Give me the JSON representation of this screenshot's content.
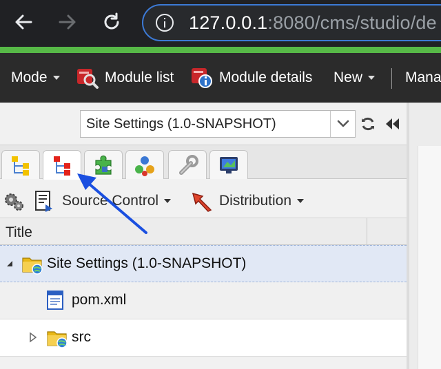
{
  "browser": {
    "url_host": "127.0.0.1",
    "url_path": ":8080/cms/studio/de",
    "icons": [
      "back-arrow-icon",
      "forward-arrow-icon",
      "reload-icon",
      "info-icon"
    ]
  },
  "toolbar": {
    "mode_label": "Mode",
    "module_list_label": "Module list",
    "module_details_label": "Module details",
    "new_label": "New",
    "manage_label": "Mana"
  },
  "site_select": {
    "value": "Site Settings (1.0-SNAPSHOT)"
  },
  "tabs": [
    {
      "icon": "site-tree-icon"
    },
    {
      "icon": "red-tree-icon"
    },
    {
      "icon": "puzzle-icon"
    },
    {
      "icon": "components-icon"
    },
    {
      "icon": "wrench-icon"
    },
    {
      "icon": "monitor-icon"
    }
  ],
  "tools": {
    "source_control_label": "Source Control",
    "distribution_label": "Distribution"
  },
  "tree": {
    "column_title": "Title",
    "rows": [
      {
        "label": "Site Settings (1.0-SNAPSHOT)",
        "icon": "site-folder-icon"
      },
      {
        "label": "pom.xml",
        "icon": "file-icon"
      },
      {
        "label": "src",
        "icon": "folder-icon"
      }
    ]
  },
  "colors": {
    "accent_blue": "#1a4fe0",
    "load_bar": "#57b947",
    "selected_row": "#e1e8f5"
  }
}
